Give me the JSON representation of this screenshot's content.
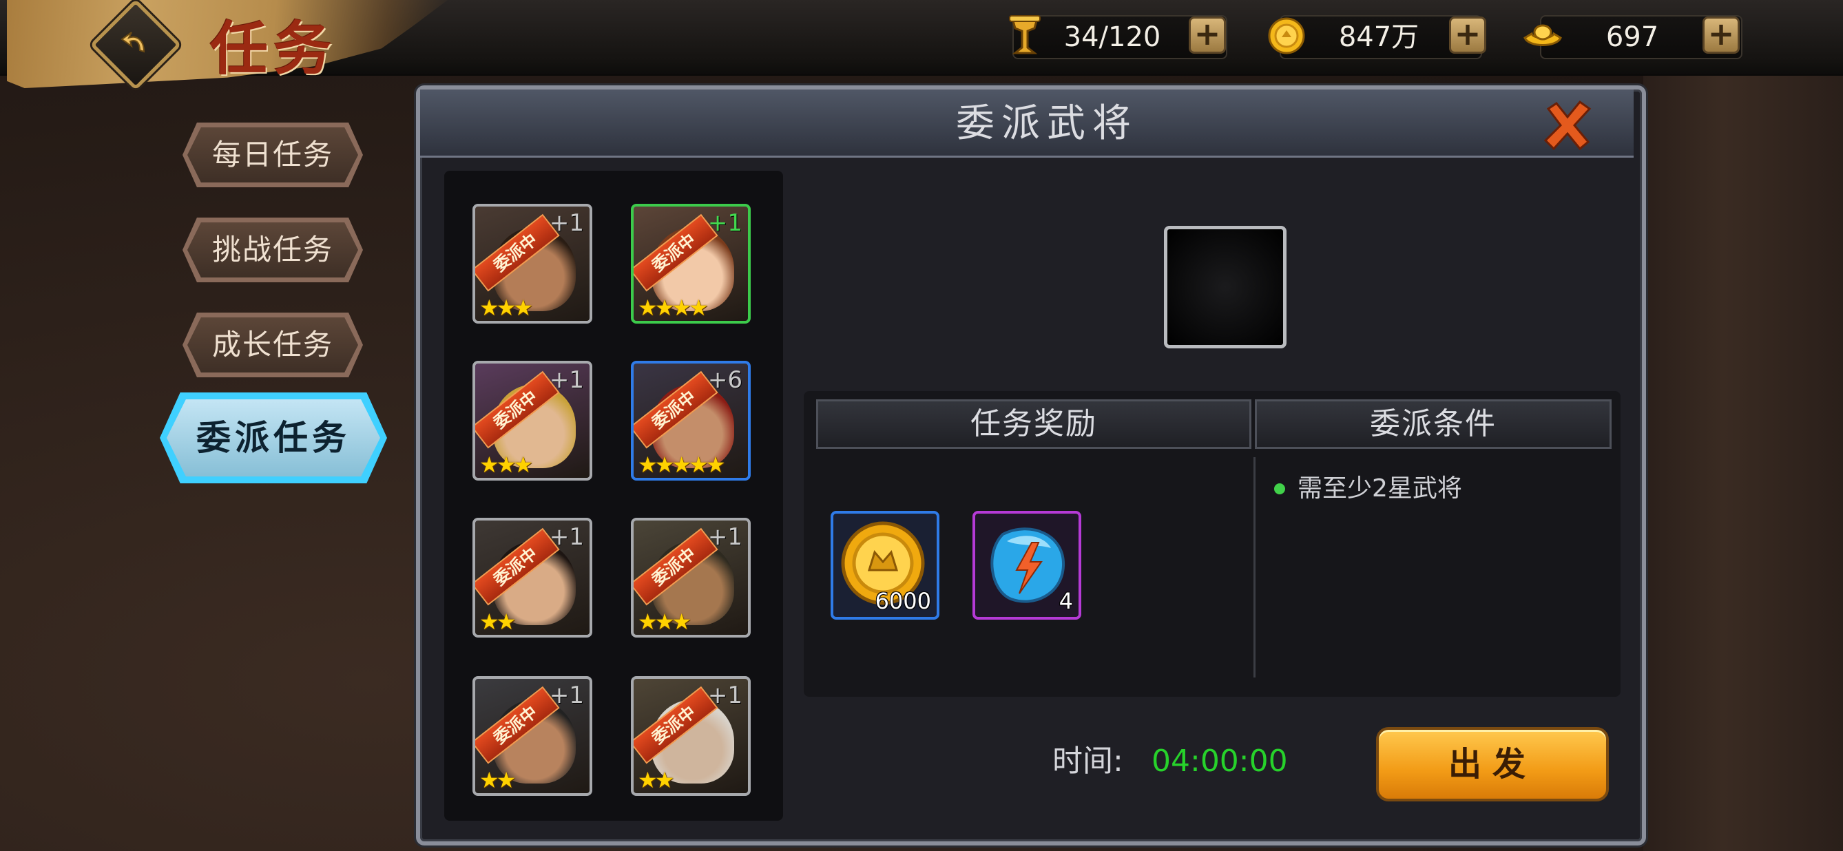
{
  "header": {
    "title": "任务",
    "resources": [
      {
        "name": "stamina",
        "value": "34/120"
      },
      {
        "name": "coins",
        "value": "847万"
      },
      {
        "name": "ingots",
        "value": "697"
      }
    ]
  },
  "nav": {
    "tabs": [
      {
        "label": "每日任务",
        "active": false
      },
      {
        "label": "挑战任务",
        "active": false
      },
      {
        "label": "成长任务",
        "active": false
      },
      {
        "label": "委派任务",
        "active": true
      }
    ]
  },
  "dialog": {
    "title": "委派武将",
    "heroes": [
      {
        "ribbon": "委派中",
        "plus": "+1",
        "stars": 3,
        "border": "gray",
        "skin": "#b47d57",
        "hair": "#2a1d14",
        "bg": "#4a3b33"
      },
      {
        "ribbon": "委派中",
        "plus": "+1",
        "stars": 4,
        "border": "green",
        "skin": "#f2c9a8",
        "hair": "#7a3b1c",
        "bg": "#5c4538"
      },
      {
        "ribbon": "委派中",
        "plus": "+1",
        "stars": 3,
        "border": "gray",
        "skin": "#e1b891",
        "hair": "#c9a239",
        "bg": "#5a3c5c"
      },
      {
        "ribbon": "委派中",
        "plus": "+6",
        "stars": 5,
        "border": "blue",
        "skin": "#c48e6a",
        "hair": "#8a1c14",
        "bg": "#3a3544"
      },
      {
        "ribbon": "委派中",
        "plus": "+1",
        "stars": 2,
        "border": "gray",
        "skin": "#d9ab86",
        "hair": "#1d1512",
        "bg": "#3e3834"
      },
      {
        "ribbon": "委派中",
        "plus": "+1",
        "stars": 3,
        "border": "gray",
        "skin": "#a5774f",
        "hair": "#2e2a20",
        "bg": "#4b4538"
      },
      {
        "ribbon": "委派中",
        "plus": "+1",
        "stars": 2,
        "border": "gray",
        "skin": "#b8835e",
        "hair": "#222",
        "bg": "#3b3b3f"
      },
      {
        "ribbon": "委派中",
        "plus": "+1",
        "stars": 2,
        "border": "gray",
        "skin": "#cfb59d",
        "hair": "#d9d4cc",
        "bg": "#4e4536"
      }
    ],
    "reward_header": "任务奖励",
    "condition_header": "委派条件",
    "rewards": [
      {
        "type": "coin",
        "count": "6000"
      },
      {
        "type": "energy-gem",
        "count": "4"
      }
    ],
    "condition": "需至少2星武将",
    "time_label": "时间:",
    "time_value": "04:00:00",
    "go_button": "出发"
  },
  "colors": {
    "time": "#27d22b",
    "nav_active": "#3fd0ff",
    "go_button": "#f29b16"
  }
}
